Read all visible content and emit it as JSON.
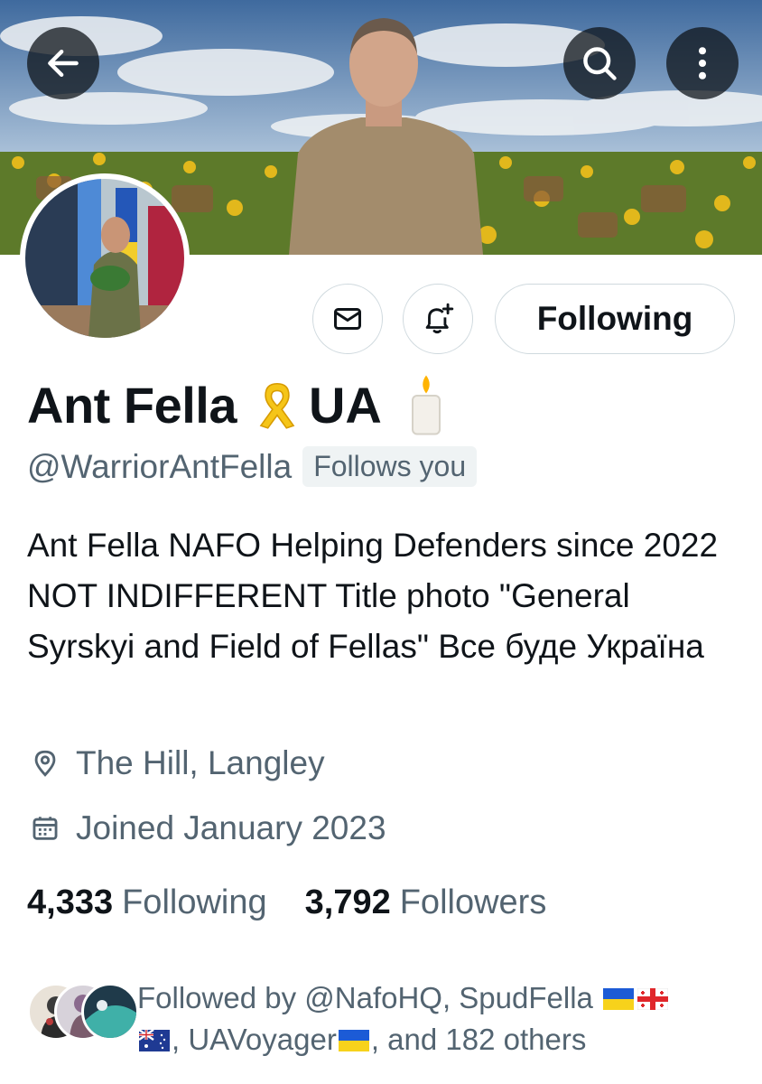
{
  "header": {
    "back_icon": "arrow-left-icon",
    "search_icon": "search-icon",
    "more_icon": "more-vertical-icon"
  },
  "profile": {
    "display_name": "Ant Fella",
    "name_ribbon_icon": "yellow-ribbon-icon",
    "name_suffix": "UA",
    "name_candle_icon": "candle-icon",
    "handle": "@WarriorAntFella",
    "follows_you": "Follows you",
    "bio": "Ant Fella NAFO Helping Defenders since 2022  NOT INDIFFERENT Title photo \"General Syrskyi and Field of Fellas\" Все буде Україна",
    "location": "The Hill, Langley",
    "joined": "Joined January 2023"
  },
  "actions": {
    "message_icon": "envelope-icon",
    "notify_icon": "bell-plus-icon",
    "following_label": "Following"
  },
  "stats": {
    "following_count": "4,333",
    "following_label": "Following",
    "followers_count": "3,792",
    "followers_label": "Followers"
  },
  "followed_by": {
    "prefix": "Followed by @NafoHQ, SpudFella",
    "middle": ", UAVoyager",
    "suffix": ", and 182 others",
    "flags": [
      "ukraine-flag-icon",
      "georgia-flag-icon",
      "australia-flag-icon",
      "ukraine-flag-icon"
    ]
  },
  "colors": {
    "text_primary": "#0f1419",
    "text_secondary": "#536471",
    "border": "#cfd9de",
    "badge_bg": "#eff3f4"
  }
}
